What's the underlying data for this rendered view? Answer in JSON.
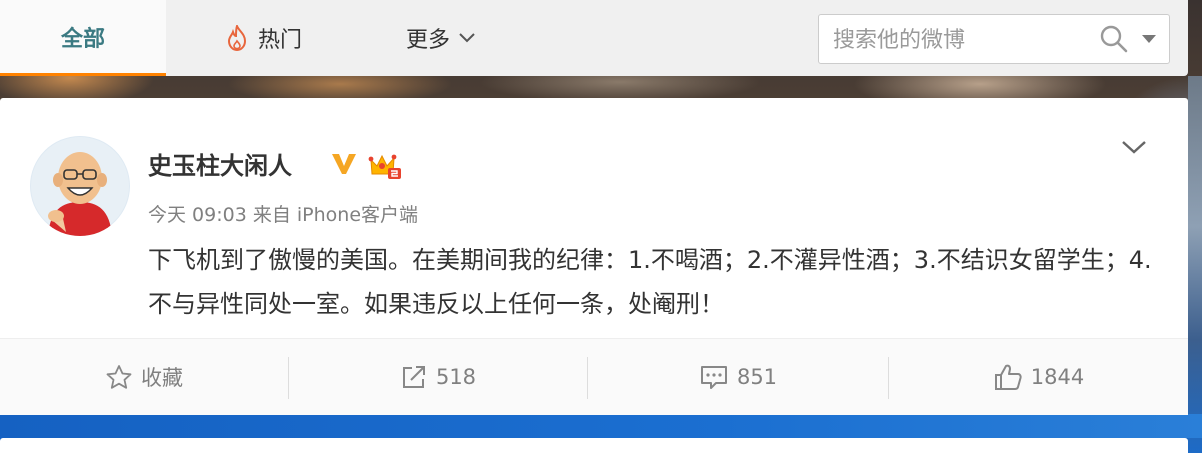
{
  "tabs": {
    "all": "全部",
    "hot": "热门",
    "more": "更多"
  },
  "search": {
    "placeholder": "搜索他的微博"
  },
  "post": {
    "username": "史玉柱大闲人",
    "time": "今天 09:03",
    "source_prefix": "来自",
    "source": "iPhone客户端",
    "text": "下飞机到了傲慢的美国。在美期间我的纪律：1.不喝酒；2.不灌异性酒；3.不结识女留学生；4.不与异性同处一室。如果违反以上任何一条，处阉刑！"
  },
  "actions": {
    "favorite": "收藏",
    "repost": "518",
    "comment": "851",
    "like": "1844"
  },
  "colors": {
    "accent": "#ff8200",
    "tab_active_text": "#3b7a82",
    "verified": "#f5a623"
  },
  "icons": [
    "fire-icon",
    "chevron-down-icon",
    "search-icon",
    "caret-down-icon",
    "verified-v-icon",
    "vip-crown-icon",
    "star-icon",
    "repost-icon",
    "comment-icon",
    "like-icon"
  ]
}
